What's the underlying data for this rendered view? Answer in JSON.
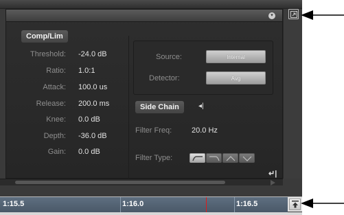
{
  "comp_lim": {
    "section_label": "Comp/Lim",
    "params": [
      {
        "label": "Threshold:",
        "value": "-24.0 dB"
      },
      {
        "label": "Ratio:",
        "value": "1.0:1"
      },
      {
        "label": "Attack:",
        "value": "100.0 us"
      },
      {
        "label": "Release:",
        "value": "200.0 ms"
      },
      {
        "label": "Knee:",
        "value": "0.0 dB"
      },
      {
        "label": "Depth:",
        "value": "-36.0 dB"
      },
      {
        "label": "Gain:",
        "value": "0.0 dB"
      }
    ]
  },
  "source": {
    "source_label": "Source:",
    "source_value": "Internal",
    "detector_label": "Detector:",
    "detector_value": "Avg"
  },
  "side_chain": {
    "section_label": "Side Chain",
    "key_icon": "key-listen-icon",
    "filter_freq_label": "Filter Freq:",
    "filter_freq_value": "20.0 Hz",
    "filter_type_label": "Filter Type:",
    "filter_types": [
      "high-pass-icon",
      "low-pass-icon",
      "band-pass-icon",
      "band-reject-icon"
    ],
    "active_filter_index": 0
  },
  "timeline": {
    "ticks": [
      "1:15.5",
      "1:16.0",
      "1:16.5"
    ]
  },
  "icons": {
    "float_button": "float-window-icon",
    "expand_button": "expand-view-icon",
    "link": "side-chain-link-icon"
  }
}
